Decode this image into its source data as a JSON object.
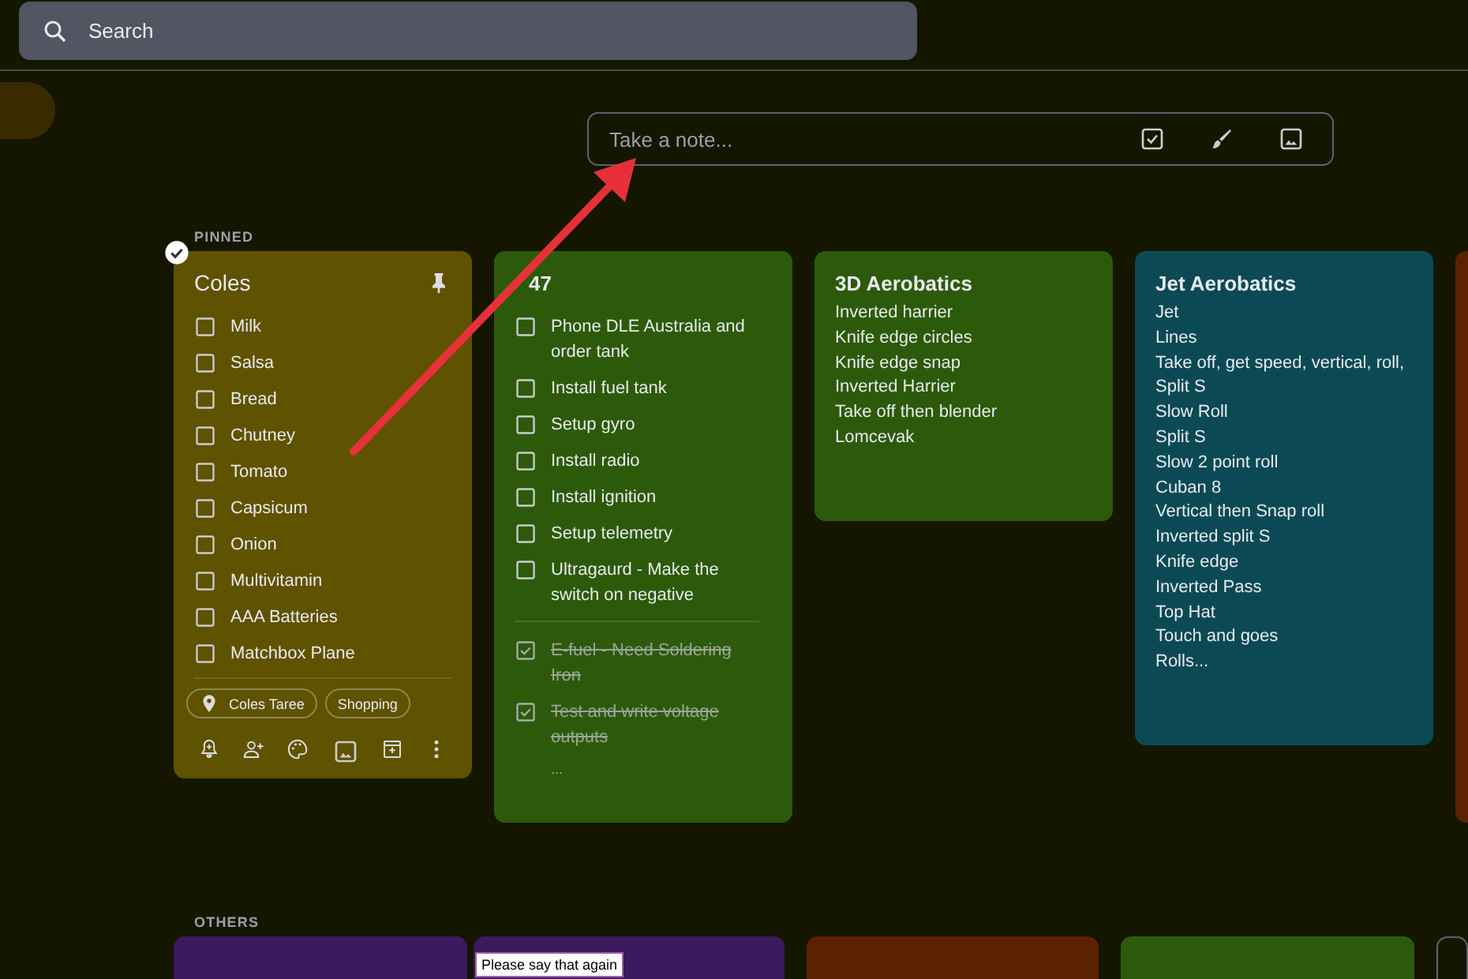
{
  "search": {
    "placeholder": "Search"
  },
  "take_note": {
    "placeholder": "Take a note..."
  },
  "pinned_label": "PINNED",
  "pinned": [
    {
      "kind": "checklist",
      "title": "Coles",
      "color": "#5f5200",
      "selected": true,
      "pinned": true,
      "items": [
        {
          "text": "Milk",
          "checked": false
        },
        {
          "text": "Salsa",
          "checked": false
        },
        {
          "text": "Bread",
          "checked": false
        },
        {
          "text": "Chutney",
          "checked": false
        },
        {
          "text": "Tomato",
          "checked": false
        },
        {
          "text": "Capsicum",
          "checked": false
        },
        {
          "text": "Onion",
          "checked": false
        },
        {
          "text": "Multivitamin",
          "checked": false
        },
        {
          "text": "AAA Batteries",
          "checked": false
        },
        {
          "text": "Matchbox Plane",
          "checked": false
        }
      ],
      "chips": [
        {
          "kind": "location",
          "label": "Coles Taree"
        },
        {
          "kind": "label",
          "label": "Shopping"
        }
      ],
      "toolbar": true
    },
    {
      "kind": "checklist",
      "title": "47",
      "color": "#2d5a0a",
      "selected": false,
      "pinned": false,
      "items": [
        {
          "text": "Phone DLE Australia and order tank",
          "checked": false
        },
        {
          "text": "Install fuel tank",
          "checked": false
        },
        {
          "text": "Setup gyro",
          "checked": false
        },
        {
          "text": "Install radio",
          "checked": false
        },
        {
          "text": "Install ignition",
          "checked": false
        },
        {
          "text": "Setup telemetry",
          "checked": false
        },
        {
          "text": "Ultragaurd - Make the switch on negative",
          "checked": false
        },
        {
          "text": "E-fuel - Need Soldering Iron",
          "checked": true
        },
        {
          "text": "Test and write voltage outputs",
          "checked": true
        }
      ],
      "more": "..."
    },
    {
      "kind": "text",
      "title": "3D Aerobatics",
      "color": "#2d5a0a",
      "selected": false,
      "pinned": false,
      "lines": [
        "Inverted harrier",
        "Knife edge circles",
        "Knife edge snap",
        "Inverted Harrier",
        "Take off then blender",
        "Lomcevak"
      ]
    },
    {
      "kind": "text",
      "title": "Jet Aerobatics",
      "color": "#0b4a55",
      "selected": false,
      "pinned": false,
      "lines": [
        "Jet",
        "Lines",
        "Take off, get speed, vertical, roll,",
        "Split S",
        "Slow Roll",
        "Split S",
        "Slow 2 point roll",
        "Cuban 8",
        "Vertical then Snap roll",
        "Inverted split S",
        "Knife edge",
        "Inverted Pass",
        "Top Hat",
        "Touch and goes",
        "Rolls..."
      ]
    },
    {
      "kind": "edge",
      "color": "#5c2100"
    }
  ],
  "others_label": "OTHERS",
  "others": [
    {
      "color": "#3b1a5e"
    },
    {
      "color": "#3b1a5e"
    },
    {
      "color": "#5c2100"
    },
    {
      "color": "#2d5a0a"
    },
    {
      "color": "#5f6368"
    }
  ],
  "tooltip": "Please say that again"
}
